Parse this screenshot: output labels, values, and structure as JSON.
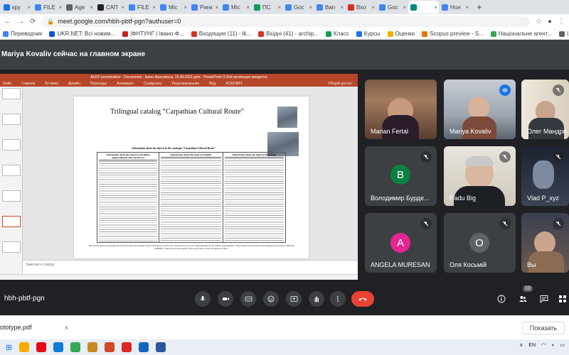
{
  "browser": {
    "tabs": [
      {
        "label": "кру",
        "color": "#1a73e8",
        "active": false
      },
      {
        "label": "FILE",
        "color": "#4285f4",
        "active": false
      },
      {
        "label": "Age",
        "color": "#5f6368",
        "active": false
      },
      {
        "label": "САП",
        "color": "#202124",
        "active": false
      },
      {
        "label": "FILE",
        "color": "#4285f4",
        "active": false
      },
      {
        "label": "Mic",
        "color": "#4285f4",
        "active": false
      },
      {
        "label": "Ринк",
        "color": "#4285f4",
        "active": false
      },
      {
        "label": "Mic",
        "color": "#4285f4",
        "active": false
      },
      {
        "label": "ПС",
        "color": "#0f9d58",
        "active": false
      },
      {
        "label": "Goc",
        "color": "#4285f4",
        "active": false
      },
      {
        "label": "Ban",
        "color": "#4285f4",
        "active": false
      },
      {
        "label": "Вхо",
        "color": "#d93025",
        "active": false
      },
      {
        "label": "Goc",
        "color": "#4285f4",
        "active": false
      },
      {
        "label": "",
        "color": "#00897b",
        "active": true
      },
      {
        "label": "Нон",
        "color": "#4285f4",
        "active": false
      }
    ],
    "url": "meet.google.com/hbh-pbtf-pgn?authuser=0",
    "bookmarks": [
      {
        "label": "Переводчик",
        "color": "#4285f4"
      },
      {
        "label": "UKR.NET: Всі новим...",
        "color": "#0b57d0"
      },
      {
        "label": "|ФНТУНГ | Івано-Ф...",
        "color": "#c5221f"
      },
      {
        "label": "Входящие (11) - lk...",
        "color": "#d93025"
      },
      {
        "label": "Вхідні (41) - archip...",
        "color": "#d93025"
      },
      {
        "label": "Класс",
        "color": "#0f9d58"
      },
      {
        "label": "Курсы",
        "color": "#1a73e8"
      },
      {
        "label": "Оценки",
        "color": "#f9ab00"
      },
      {
        "label": "Scopus preview - S...",
        "color": "#e37400"
      },
      {
        "label": "Національне агент...",
        "color": "#34a853"
      },
      {
        "label": "l.konsevich@nung.e...",
        "color": "#5f6368"
      }
    ]
  },
  "meet": {
    "presenter_text": "Mariya Kovaliv сейчас на главном экране",
    "meeting_code": "hbh-pbtf-pgn",
    "participants_count": "10",
    "participants": [
      {
        "name": "Marian Fertal",
        "muted": false,
        "speaking": false,
        "avatar_letter": "",
        "avatar_color": ""
      },
      {
        "name": "Mariya Kovaliv",
        "muted": false,
        "speaking": true,
        "avatar_letter": "",
        "avatar_color": ""
      },
      {
        "name": "Олег Мандри",
        "muted": true,
        "speaking": false,
        "avatar_letter": "",
        "avatar_color": ""
      },
      {
        "name": "Володимир Бурде...",
        "muted": true,
        "speaking": false,
        "avatar_letter": "В",
        "avatar_color": "#0b8043"
      },
      {
        "name": "Radu Big",
        "muted": true,
        "speaking": false,
        "avatar_letter": "",
        "avatar_color": ""
      },
      {
        "name": "Vlad P_xyz",
        "muted": true,
        "speaking": false,
        "avatar_letter": "",
        "avatar_color": ""
      },
      {
        "name": "ANGELA MURESAN",
        "muted": true,
        "speaking": false,
        "avatar_letter": "A",
        "avatar_color": "#e52592"
      },
      {
        "name": "Оля Косьмій",
        "muted": true,
        "speaking": false,
        "avatar_letter": "О",
        "avatar_color": "#5f6368"
      },
      {
        "name": "Вы",
        "muted": true,
        "speaking": false,
        "avatar_letter": "",
        "avatar_color": ""
      }
    ]
  },
  "presentation": {
    "window_title": "AEDV presentation - Documents - Івано-Франківськ, 15.04.2021.pptx - PowerPoint (Сбой активации продукта)",
    "ribbon_tabs": [
      "Файл",
      "Главная",
      "Вставка",
      "Дизайн",
      "Переходы",
      "Анимация",
      "Слайд-шоу",
      "Рецензирование",
      "Вид",
      "ACROBAT"
    ],
    "share_label": "Общий доступ",
    "slide_title": "Trilingual catalog “Carpathian Cultural Route”",
    "table_caption": "Information about the objects in the catalogue “Carpathian Cultural Route”",
    "columns": [
      "Information about the object in Ukrainian (approximately 600 characters)",
      "Information about the object in English",
      "Information about the object in Romanian"
    ],
    "footer_text": "This publication was produced with the financial support of the European Union. Its contents are the sole responsibility of the public organization \"Association of Economic Development of Ivano-Frankivsk (AEDIF)\" and do not necessarily reflect the views of the European Union.",
    "notes_placeholder": "Заметки к слайду"
  },
  "downloads": {
    "file": "ototype.pdf",
    "show_all": "Показать"
  },
  "taskbar": {
    "lang": "EN",
    "icons": [
      {
        "name": "file-explorer-icon",
        "color": "#f9ab00"
      },
      {
        "name": "netflix-icon",
        "color": "#e50914"
      },
      {
        "name": "edge-icon",
        "color": "#0c7cd5"
      },
      {
        "name": "chrome-icon",
        "color": "#34a853"
      },
      {
        "name": "files-icon",
        "color": "#c58a1f"
      },
      {
        "name": "powerpoint-icon",
        "color": "#d24726"
      },
      {
        "name": "acrobat-icon",
        "color": "#dc2626"
      },
      {
        "name": "explorer-icon",
        "color": "#1565c0"
      },
      {
        "name": "word-icon",
        "color": "#2b579a"
      }
    ]
  },
  "colors": {
    "meet_bg": "#202124",
    "tile_bg": "#3c4043",
    "end_call": "#ea4335",
    "speaking_outline": "#8ab4f8",
    "ppt_accent": "#b7472a"
  }
}
